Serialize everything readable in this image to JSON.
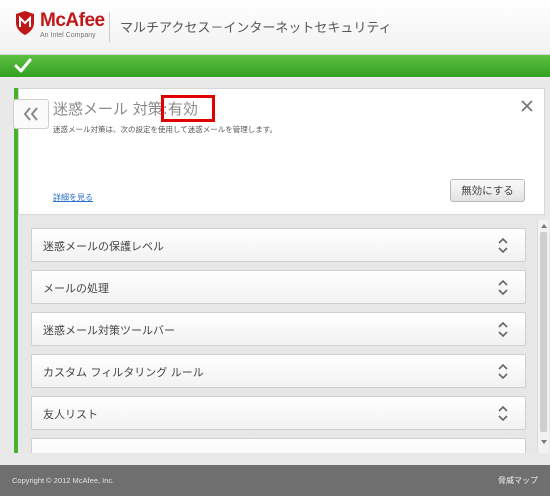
{
  "header": {
    "brand": "McAfee",
    "brand_sub": "An Intel Company",
    "product_title": "マルチアクセス－インターネットセキュリティ"
  },
  "panel": {
    "title_prefix": "迷惑メール 対策:",
    "title_state": "有効",
    "description": "迷惑メール対策は、次の設定を使用して迷惑メールを管理します。",
    "details_link": "詳細を見る",
    "disable_button": "無効にする"
  },
  "items": [
    {
      "label": "迷惑メールの保護レベル"
    },
    {
      "label": "メールの処理"
    },
    {
      "label": "迷惑メール対策ツールバー"
    },
    {
      "label": "カスタム フィルタリング ルール"
    },
    {
      "label": "友人リスト"
    }
  ],
  "footer": {
    "copyright": "Copyright © 2012 McAfee, Inc.",
    "threat_map": "脅威マップ"
  },
  "colors": {
    "brand_red": "#c01818",
    "status_green": "#47b22c",
    "highlight_red": "#e10000",
    "link_blue": "#2a6fc9"
  }
}
